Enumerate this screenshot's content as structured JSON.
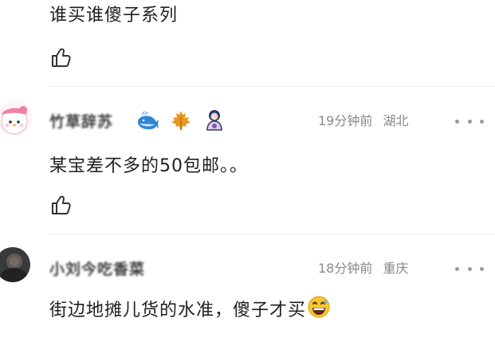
{
  "comments": [
    {
      "text": "谁买谁傻子系列"
    },
    {
      "username": "竹草辞苏",
      "time": "19分钟前",
      "location": "湖北",
      "text": "某宝差不多的50包邮。。",
      "badges": [
        "whale-icon",
        "maple-leaf-icon",
        "fan-badge-icon"
      ]
    },
    {
      "username": "小刘今吃香菜",
      "time": "18分钟前",
      "location": "重庆",
      "text": "街边地摊儿货的水准，傻子才买",
      "emoji": "grinning-sweat-emoji"
    }
  ],
  "icons": {
    "like": "thumbs-up-icon",
    "more": "more-dots-icon"
  },
  "colors": {
    "text": "#1f1f1f",
    "meta": "#8a8a8a",
    "divider": "#ececec"
  }
}
